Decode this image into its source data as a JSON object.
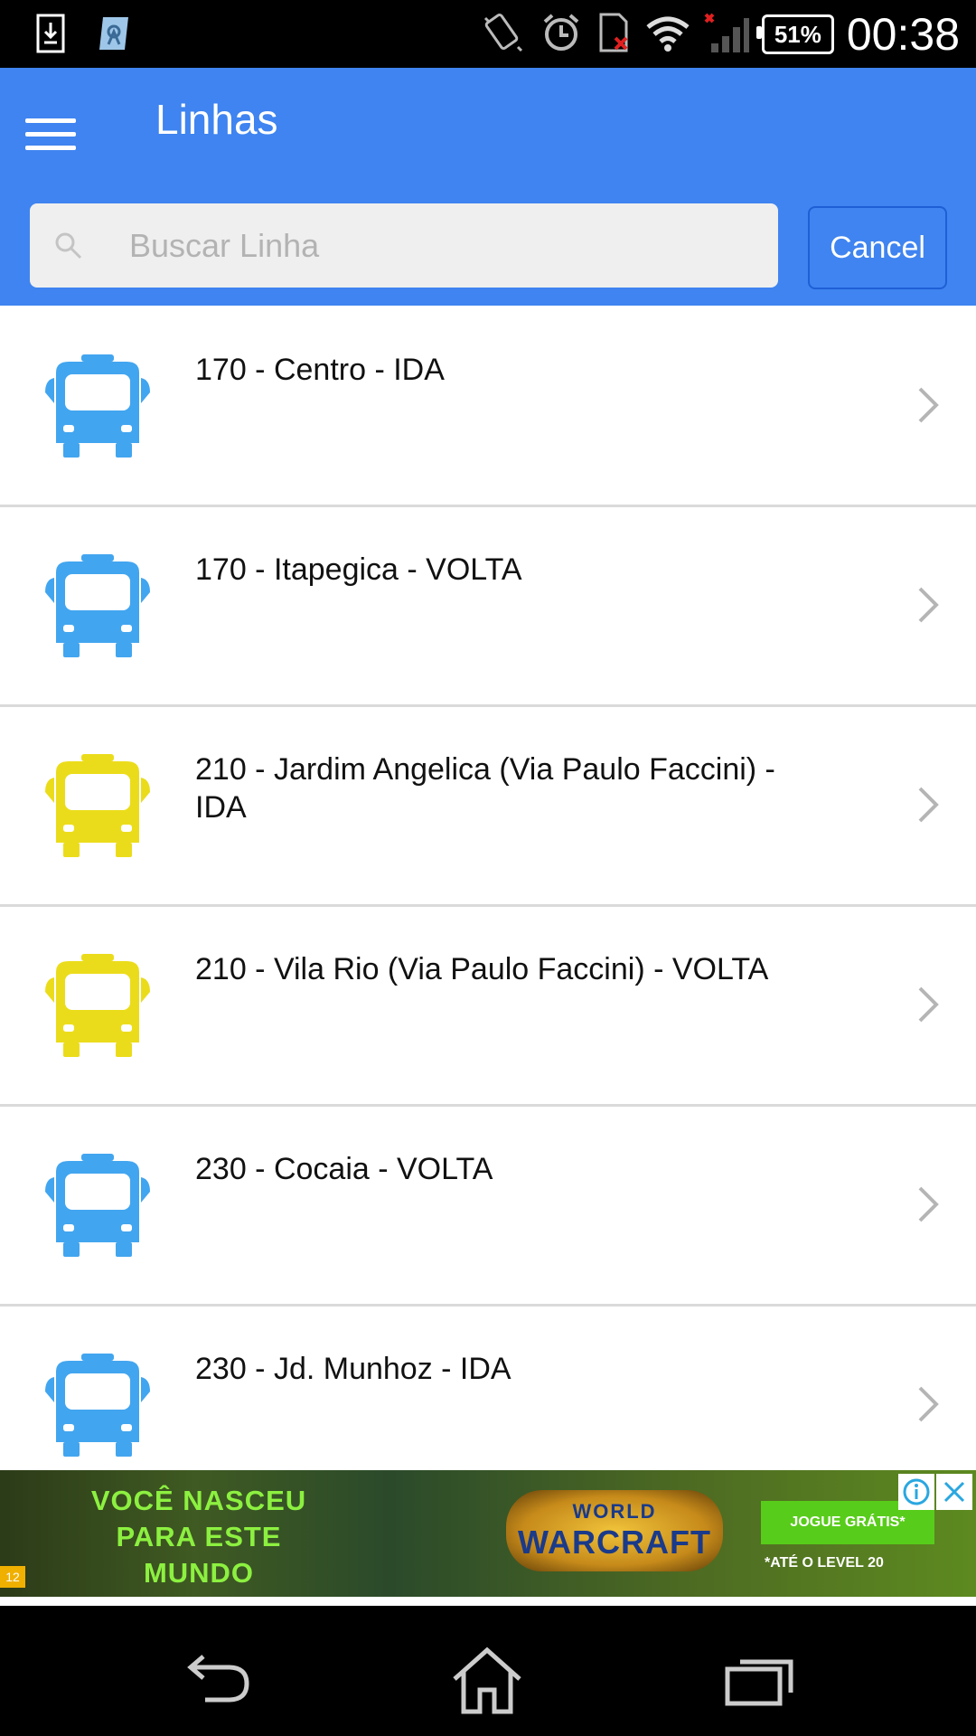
{
  "status_bar": {
    "battery_percent": "51%",
    "time": "00:38"
  },
  "header": {
    "title": "Linhas",
    "search_placeholder": "Buscar Linha",
    "search_value": "",
    "cancel_label": "Cancel"
  },
  "lines": [
    {
      "label": "170 - Centro - IDA",
      "bus_color": "#42a5ef"
    },
    {
      "label": "170 - Itapegica - VOLTA",
      "bus_color": "#42a5ef"
    },
    {
      "label": "210 - Jardim Angelica (Via Paulo Faccini) - IDA",
      "bus_color": "#ebdc1b"
    },
    {
      "label": "210 - Vila Rio (Via Paulo Faccini) - VOLTA",
      "bus_color": "#ebdc1b"
    },
    {
      "label": "230 - Cocaia - VOLTA",
      "bus_color": "#42a5ef"
    },
    {
      "label": "230 - Jd. Munhoz - IDA",
      "bus_color": "#42a5ef"
    }
  ],
  "ad": {
    "headline_1": "VOCÊ NASCEU",
    "headline_2": "PARA ESTE",
    "headline_3": "MUNDO",
    "logo_top": "WORLD",
    "logo_main": "WARCRAFT",
    "cta": "JOGUE GRÁTIS*",
    "sub": "*ATÉ O LEVEL 20",
    "rating": "12"
  },
  "colors": {
    "header_blue": "#3f84f0",
    "accent_dark_blue": "#1f5fd6"
  }
}
